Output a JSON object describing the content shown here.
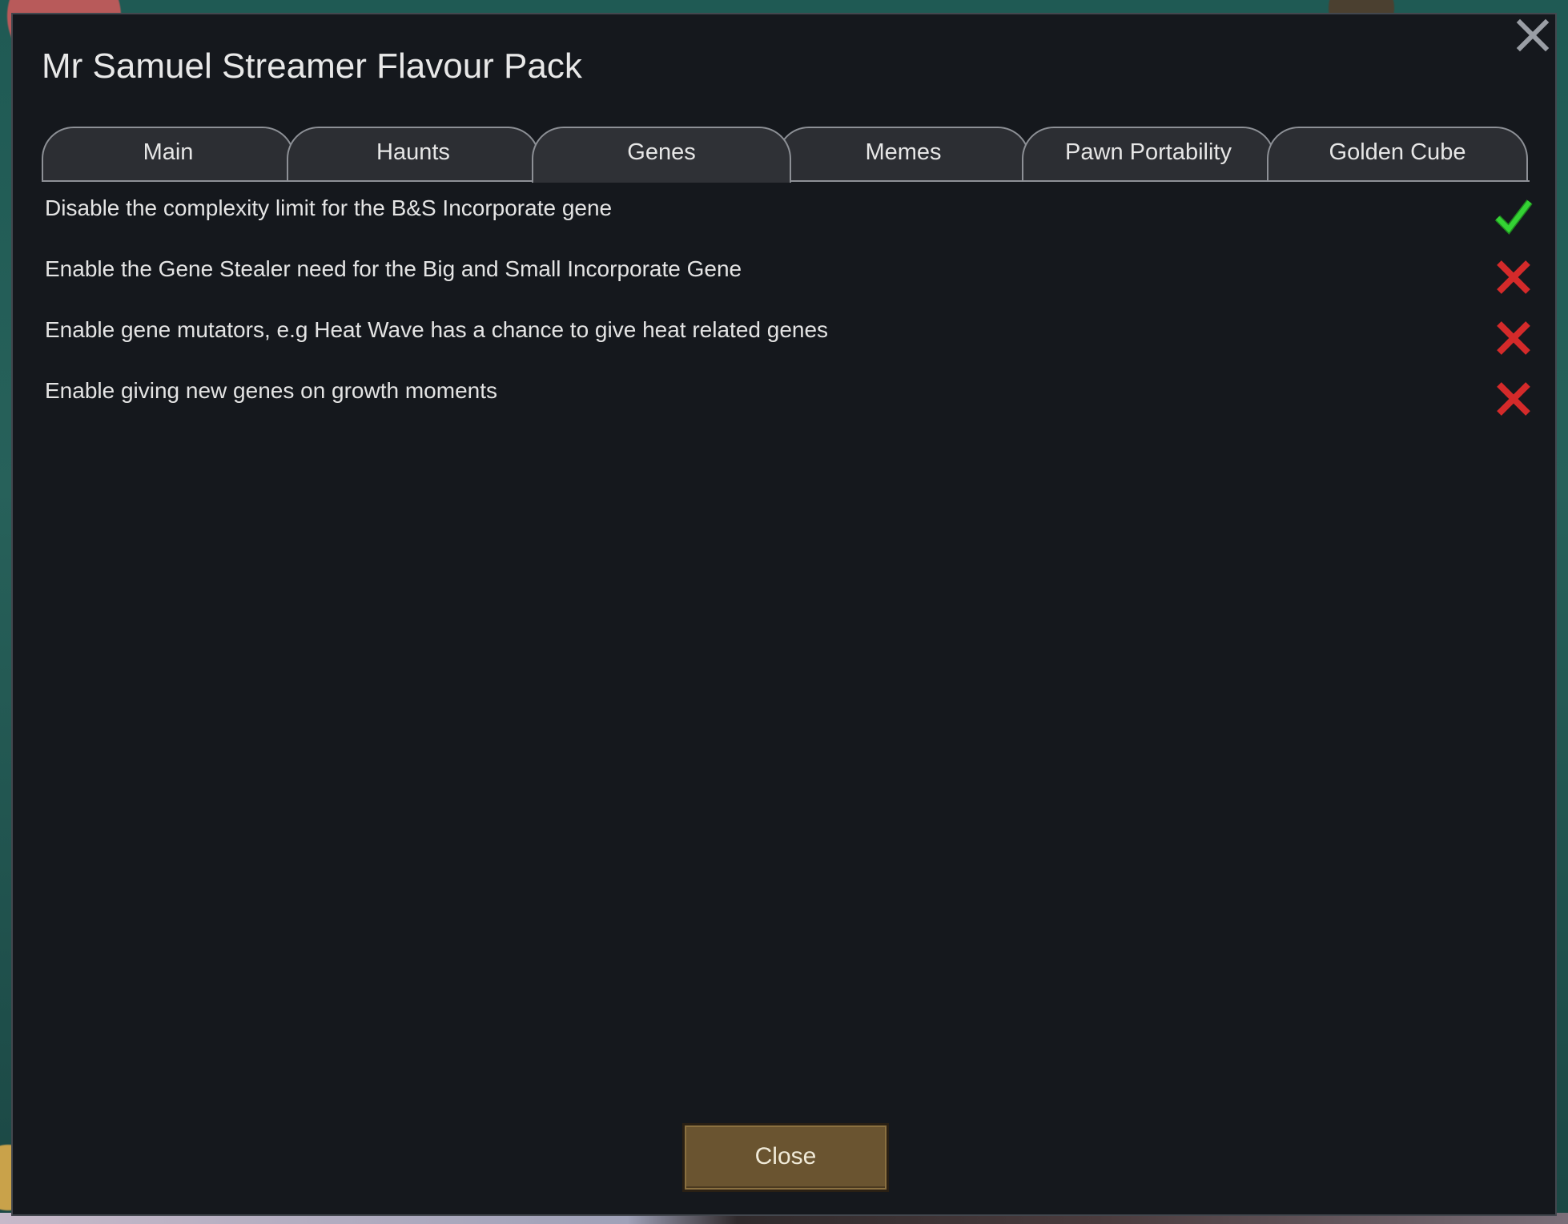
{
  "dialog": {
    "title": "Mr Samuel Streamer Flavour Pack",
    "close_icon": "close-x-icon"
  },
  "tabs": [
    {
      "label": "Main",
      "active": false
    },
    {
      "label": "Haunts",
      "active": false
    },
    {
      "label": "Genes",
      "active": true
    },
    {
      "label": "Memes",
      "active": false
    },
    {
      "label": "Pawn Portability",
      "active": false
    },
    {
      "label": "Golden Cube",
      "active": false
    }
  ],
  "options": [
    {
      "label": "Disable the complexity limit for the B&S Incorporate gene",
      "enabled": true
    },
    {
      "label": "Enable the Gene Stealer need for the Big and Small Incorporate Gene",
      "enabled": false
    },
    {
      "label": "Enable gene mutators, e.g Heat Wave has a chance to give heat related genes",
      "enabled": false
    },
    {
      "label": "Enable giving new genes on growth moments",
      "enabled": false
    }
  ],
  "footer": {
    "close_label": "Close"
  },
  "colors": {
    "check": "#2ec82e",
    "cross": "#d42a2a",
    "button": "#6a5430"
  }
}
